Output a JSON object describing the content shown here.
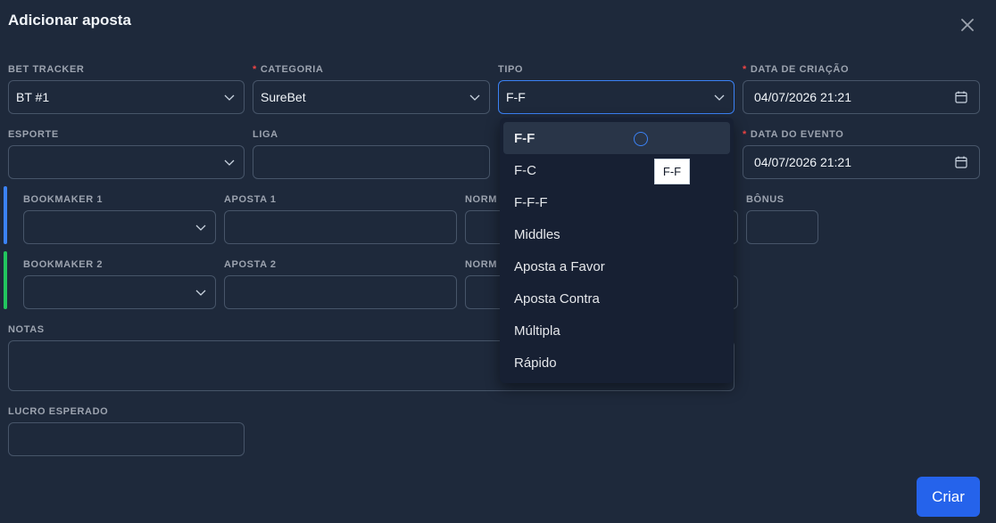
{
  "modal": {
    "title": "Adicionar aposta",
    "create_label": "Criar"
  },
  "form": {
    "bet_tracker": {
      "label": "BET TRACKER",
      "value": "BT #1"
    },
    "categoria": {
      "label": "CATEGORIA",
      "value": "SureBet",
      "required": true
    },
    "tipo": {
      "label": "TIPO",
      "value": "F-F"
    },
    "data_criacao": {
      "label": "DATA DE CRIAÇÃO",
      "value": "04/07/2026 21:21",
      "required": true
    },
    "esporte": {
      "label": "ESPORTE",
      "value": ""
    },
    "liga": {
      "label": "LIGA",
      "value": ""
    },
    "data_evento": {
      "label": "DATA DO EVENTO",
      "value": "04/07/2026 21:21",
      "required": true
    },
    "bookmaker1": {
      "label": "BOOKMAKER 1",
      "aposta_label": "APOSTA 1",
      "norm_label": "NORM",
      "bonus_label": "BÔNUS",
      "accent": "#3b82f6"
    },
    "bookmaker2": {
      "label": "BOOKMAKER 2",
      "aposta_label": "APOSTA 2",
      "norm_label": "NORM",
      "accent": "#22c55e"
    },
    "notas": {
      "label": "NOTAS",
      "value": ""
    },
    "lucro": {
      "label": "LUCRO ESPERADO",
      "value": ""
    }
  },
  "dropdown": {
    "options": [
      "F-F",
      "F-C",
      "F-F-F",
      "Middles",
      "Aposta a Favor",
      "Aposta Contra",
      "Múltipla",
      "Rápido"
    ],
    "selected": "F-F",
    "tooltip": "F-F"
  },
  "colors": {
    "background": "#1e293b",
    "primary": "#2563eb",
    "required": "#ef4444"
  }
}
